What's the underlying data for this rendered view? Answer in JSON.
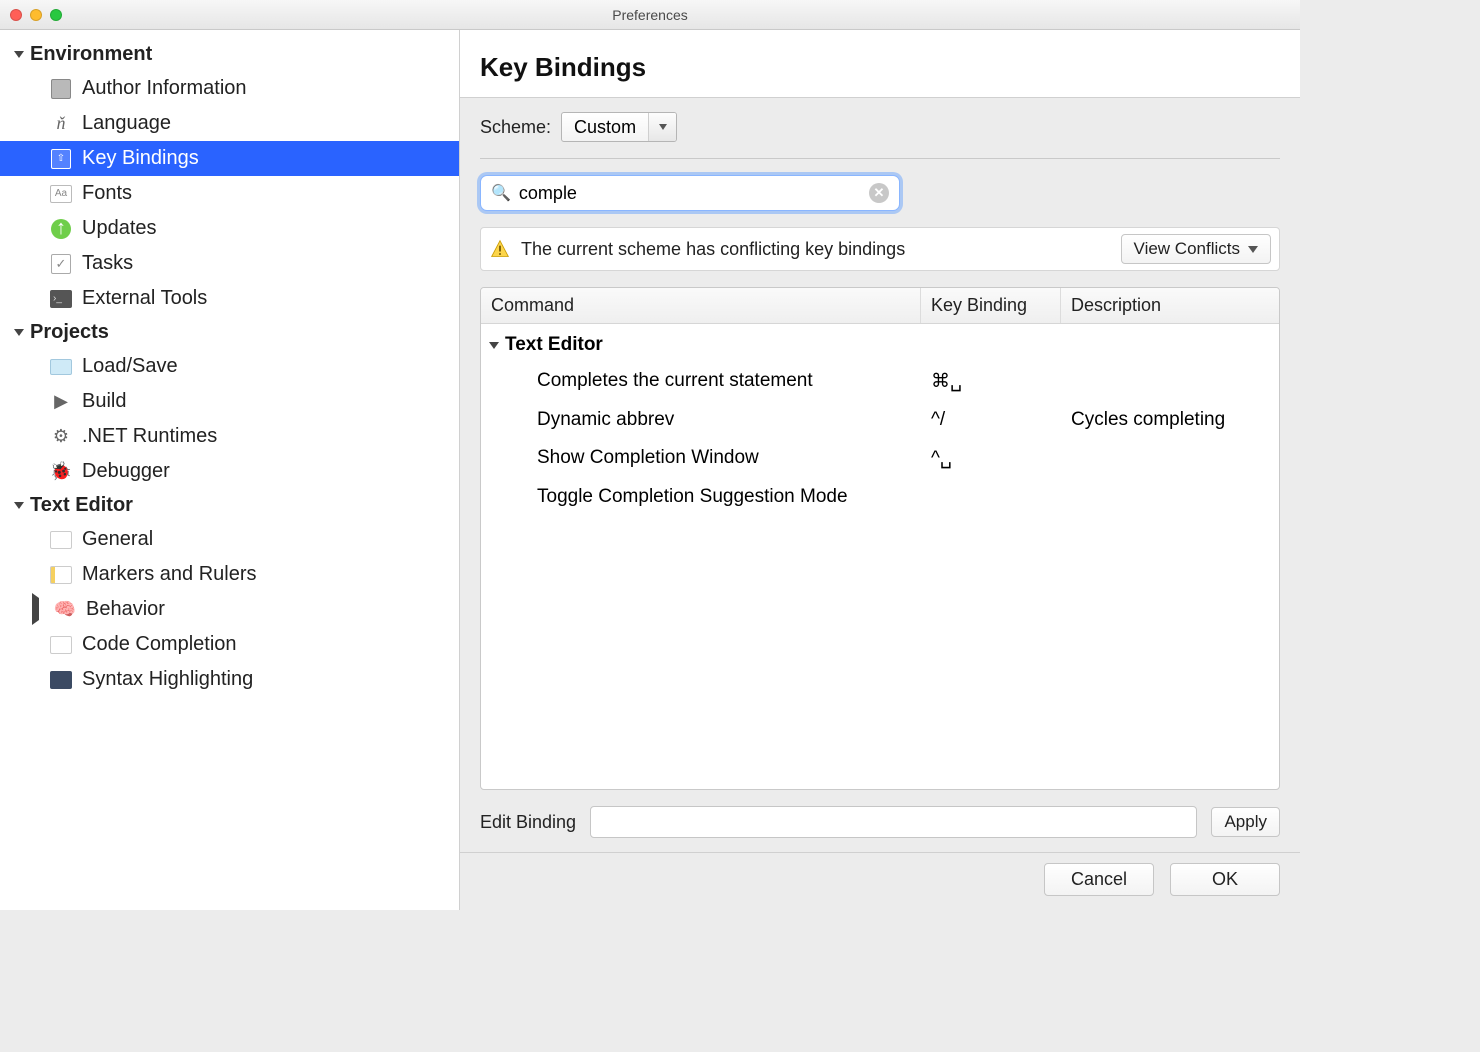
{
  "window": {
    "title": "Preferences"
  },
  "sidebar": {
    "sections": [
      {
        "title": "Environment",
        "items": [
          {
            "label": "Author Information",
            "icon": "person-icon"
          },
          {
            "label": "Language",
            "icon": "language-icon"
          },
          {
            "label": "Key Bindings",
            "icon": "key-icon",
            "selected": true
          },
          {
            "label": "Fonts",
            "icon": "fonts-icon"
          },
          {
            "label": "Updates",
            "icon": "updates-icon"
          },
          {
            "label": "Tasks",
            "icon": "check-icon"
          },
          {
            "label": "External Tools",
            "icon": "terminal-icon"
          }
        ]
      },
      {
        "title": "Projects",
        "items": [
          {
            "label": "Load/Save",
            "icon": "folder-icon"
          },
          {
            "label": "Build",
            "icon": "build-icon"
          },
          {
            "label": ".NET Runtimes",
            "icon": "gear-icon"
          },
          {
            "label": "Debugger",
            "icon": "bug-icon"
          }
        ]
      },
      {
        "title": "Text Editor",
        "items": [
          {
            "label": "General",
            "icon": "code-icon"
          },
          {
            "label": "Markers and Rulers",
            "icon": "markers-icon"
          },
          {
            "label": "Behavior",
            "icon": "brain-icon",
            "expandable": true
          },
          {
            "label": "Code Completion",
            "icon": "code-icon"
          },
          {
            "label": "Syntax Highlighting",
            "icon": "syntax-icon"
          }
        ]
      }
    ]
  },
  "content": {
    "title": "Key Bindings",
    "scheme_label": "Scheme:",
    "scheme_value": "Custom",
    "search_value": "comple",
    "search_placeholder": "Search",
    "warning_text": "The current scheme has conflicting key bindings",
    "view_conflicts_label": "View Conflicts",
    "columns": {
      "command": "Command",
      "keybinding": "Key Binding",
      "description": "Description"
    },
    "groups": [
      {
        "name": "Text Editor",
        "rows": [
          {
            "command": "Completes the current statement",
            "key": "⌘␣",
            "desc": ""
          },
          {
            "command": "Dynamic abbrev",
            "key": "^/",
            "desc": "Cycles completing"
          },
          {
            "command": "Show Completion Window",
            "key": "^␣",
            "desc": ""
          },
          {
            "command": "Toggle Completion Suggestion Mode",
            "key": "",
            "desc": ""
          }
        ]
      }
    ],
    "edit_binding_label": "Edit Binding",
    "edit_binding_value": "",
    "apply_label": "Apply"
  },
  "footer": {
    "cancel": "Cancel",
    "ok": "OK"
  }
}
